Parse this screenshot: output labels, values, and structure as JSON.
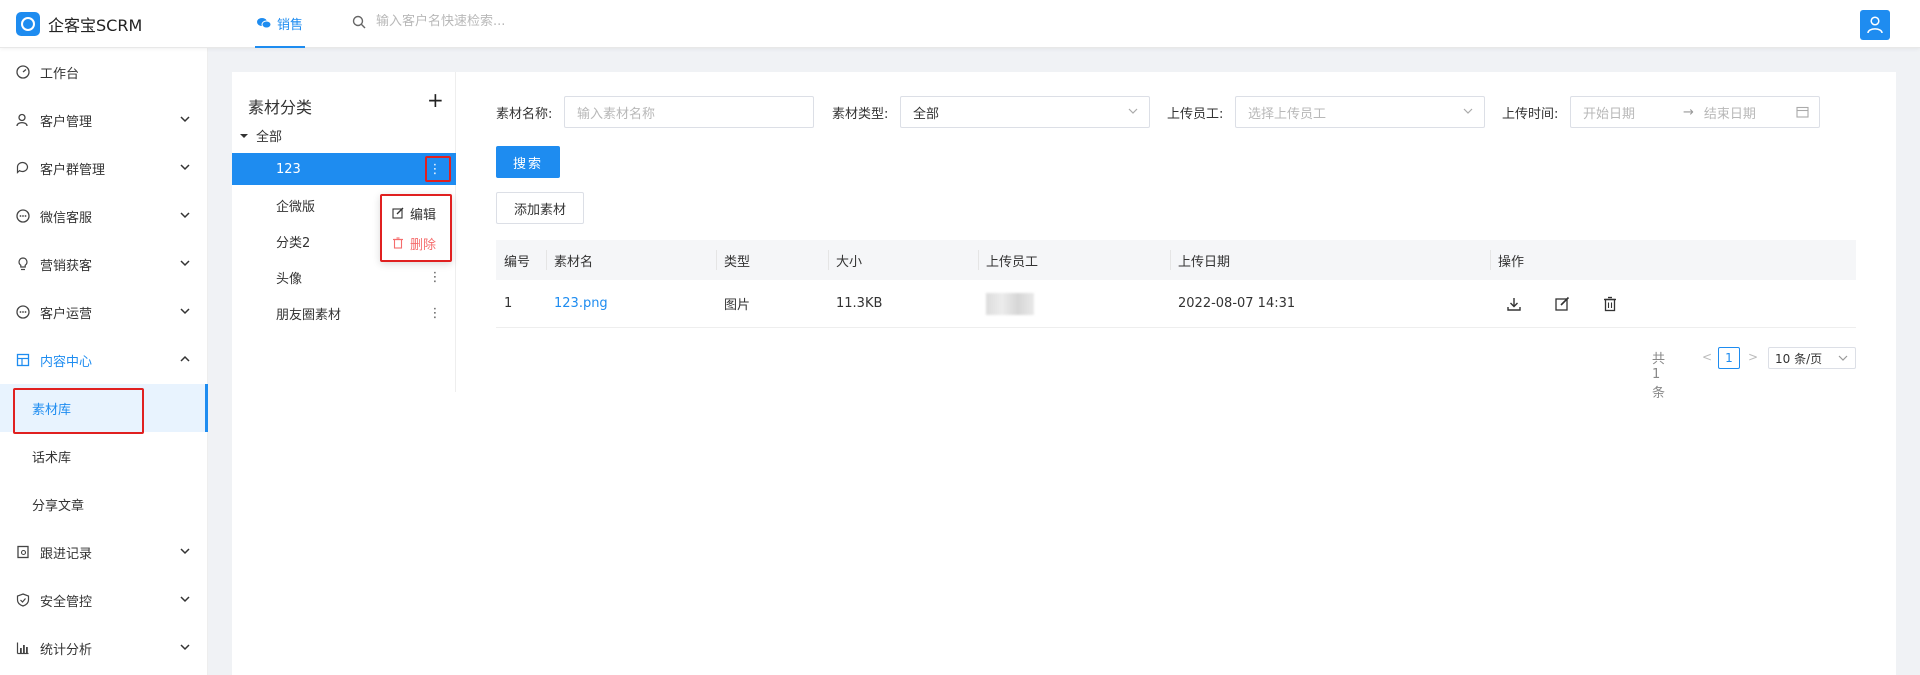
{
  "app": {
    "title": "企客宝SCRM"
  },
  "header": {
    "tab_label": "销售",
    "search_placeholder": "输入客户名快速检索..."
  },
  "sidebar": {
    "items": [
      {
        "label": "工作台"
      },
      {
        "label": "客户管理"
      },
      {
        "label": "客户群管理"
      },
      {
        "label": "微信客服"
      },
      {
        "label": "营销获客"
      },
      {
        "label": "客户运营"
      },
      {
        "label": "内容中心"
      },
      {
        "label": "跟进记录"
      },
      {
        "label": "安全管控"
      },
      {
        "label": "统计分析"
      }
    ],
    "sub_items": [
      {
        "label": "素材库"
      },
      {
        "label": "话术库"
      },
      {
        "label": "分享文章"
      }
    ]
  },
  "category": {
    "title": "素材分类",
    "add_symbol": "+",
    "root_label": "全部",
    "nodes": [
      {
        "label": "123"
      },
      {
        "label": "企微版"
      },
      {
        "label": "分类2"
      },
      {
        "label": "头像"
      },
      {
        "label": "朋友圈素材"
      }
    ],
    "menu": {
      "edit_label": "编辑",
      "delete_label": "删除"
    }
  },
  "filters": {
    "name_label": "素材名称:",
    "name_placeholder": "输入素材名称",
    "type_label": "素材类型:",
    "type_value": "全部",
    "uploader_label": "上传员工:",
    "uploader_placeholder": "选择上传员工",
    "time_label": "上传时间:",
    "start_placeholder": "开始日期",
    "range_sep": "→",
    "end_placeholder": "结束日期"
  },
  "buttons": {
    "search": "搜索",
    "add_material": "添加素材"
  },
  "table": {
    "columns": [
      "编号",
      "素材名",
      "类型",
      "大小",
      "上传员工",
      "上传日期",
      "操作"
    ],
    "rows": [
      {
        "id": "1",
        "name": "123.png",
        "type": "图片",
        "size": "11.3KB",
        "uploader": "",
        "date": "2022-08-07 14:31"
      }
    ]
  },
  "pagination": {
    "total": "共1条",
    "current_page": "1",
    "page_size": "10 条/页"
  },
  "colors": {
    "accent": "#1e8cf0",
    "highlight_box": "#e02020",
    "danger": "#f56c6c"
  }
}
